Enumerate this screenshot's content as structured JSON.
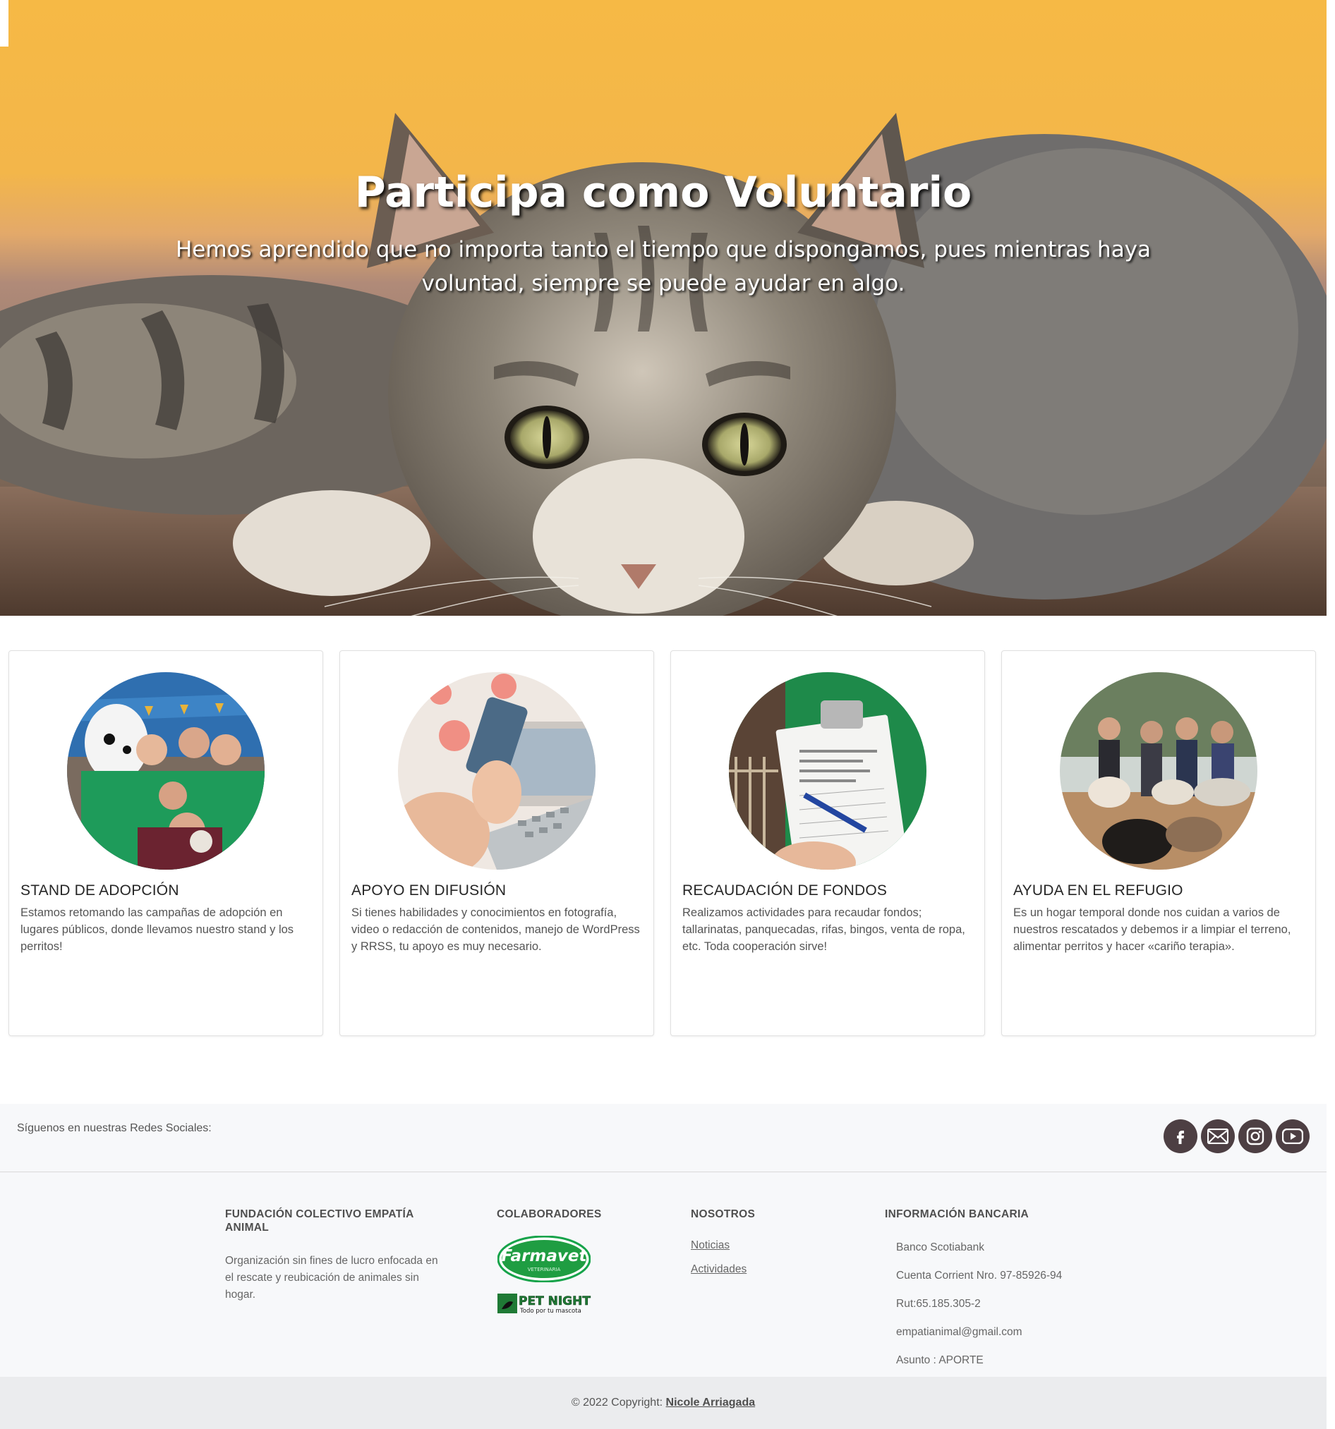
{
  "hero": {
    "title": "Participa como Voluntario",
    "subtitle": "Hemos aprendido que no importa tanto el tiempo que dispongamos, pues mientras haya voluntad, siempre se puede ayudar en algo."
  },
  "cards": [
    {
      "title": "STAND DE ADOPCIÓN",
      "text": "Estamos retomando las campañas de adopción en lugares públicos, donde llevamos nuestro stand y los perritos!"
    },
    {
      "title": "APOYO EN DIFUSIÓN",
      "text": "Si tienes habilidades y conocimientos en fotografía, video o redacción de contenidos, manejo de WordPress y RRSS, tu apoyo es muy necesario."
    },
    {
      "title": "RECAUDACIÓN DE FONDOS",
      "text": "Realizamos actividades para recaudar fondos; tallarinatas, panquecadas, rifas, bingos, venta de ropa, etc. Toda cooperación sirve!"
    },
    {
      "title": "AYUDA EN EL REFUGIO",
      "text": "Es un hogar temporal donde nos cuidan a varios de nuestros rescatados y debemos ir a limpiar el terreno, alimentar perritos y hacer «cariño terapia»."
    }
  ],
  "social": {
    "label": "Síguenos en nuestras Redes Sociales:",
    "icons": [
      "facebook-icon",
      "email-icon",
      "instagram-icon",
      "youtube-icon"
    ],
    "icon_bg": "#4d3f43"
  },
  "footer": {
    "about": {
      "heading": "FUNDACIÓN COLECTIVO EMPATÍA ANIMAL",
      "text": "Organización sin fines de lucro enfocada en el rescate y reubicación de animales sin hogar."
    },
    "partners": {
      "heading": "COLABORADORES",
      "farmavet": "Farmavet",
      "farmavet_sub": "VETERINARIA",
      "petnight": "PET NIGHT",
      "petnight_sub": "Todo por tu mascota"
    },
    "nosotros": {
      "heading": "NOSOTROS",
      "links": [
        "Noticias",
        "Actividades"
      ]
    },
    "bank": {
      "heading": "INFORMACIÓN BANCARIA",
      "lines": [
        "Banco Scotiabank",
        "Cuenta Corrient Nro. 97-85926-94",
        "Rut:65.185.305-2",
        "empatianimal@gmail.com",
        "Asunto : APORTE"
      ]
    }
  },
  "copyright": {
    "text": "© 2022 Copyright:",
    "author": "Nicole Arriagada"
  }
}
